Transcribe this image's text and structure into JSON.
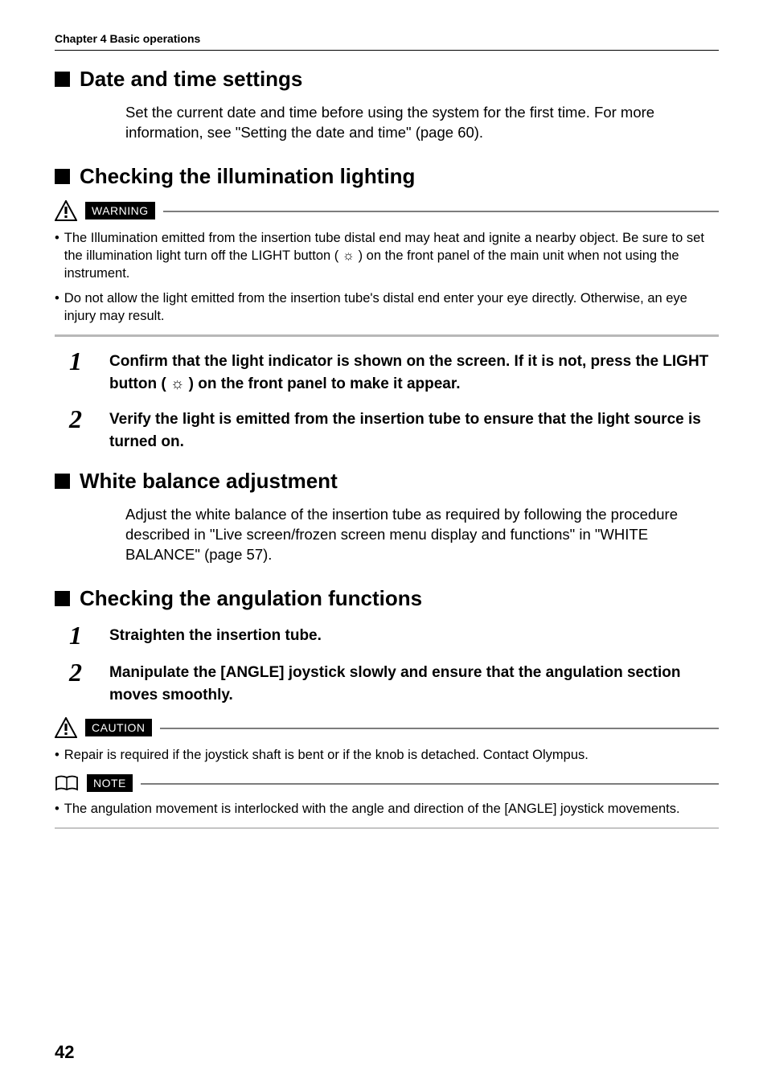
{
  "chapter_header": "Chapter 4 Basic operations",
  "section_date_time": {
    "title": "Date and time settings",
    "body": "Set the current date and time before using the system for the first time. For more information, see \"Setting the date and time\" (page 60)."
  },
  "section_illumination": {
    "title": "Checking the illumination lighting",
    "warning_label": "WARNING",
    "warnings": [
      "The Illumination emitted from the insertion tube distal end may heat and ignite a nearby object. Be sure to set the illumination light turn off the LIGHT button ( ☼ ) on the front panel of the main unit when not using the instrument.",
      "Do not allow the light emitted from the insertion tube's distal end enter your eye directly. Otherwise, an eye injury may result."
    ],
    "steps": [
      "Confirm that the light indicator is shown on the screen. If it is not, press the LIGHT button ( ☼ ) on the front panel to make it appear.",
      "Verify the light is emitted from the insertion tube to ensure that the light source is turned on."
    ]
  },
  "section_white_balance": {
    "title": "White balance adjustment",
    "body": "Adjust the white balance of the insertion tube as required by following the procedure described in \"Live screen/frozen screen menu display and functions\" in \"WHITE BALANCE\" (page 57)."
  },
  "section_angulation": {
    "title": "Checking the angulation functions",
    "steps": [
      "Straighten the insertion tube.",
      "Manipulate the [ANGLE] joystick slowly and ensure that the angulation section moves smoothly."
    ],
    "caution_label": "CAUTION",
    "caution_text": "Repair is required if the joystick shaft is bent or if the knob is detached. Contact Olympus.",
    "note_label": "NOTE",
    "note_text": "The angulation movement is interlocked with the angle and direction of the [ANGLE] joystick movements."
  },
  "page_number": "42",
  "step_numbers": [
    "1",
    "2"
  ]
}
